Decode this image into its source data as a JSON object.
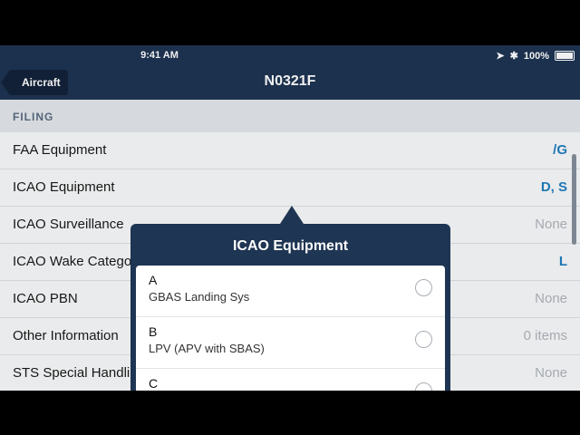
{
  "status_bar": {
    "time": "9:41 AM",
    "battery": "100%"
  },
  "nav": {
    "back_label": "Aircraft",
    "title": "N0321F"
  },
  "section": {
    "title": "FILING"
  },
  "rows": [
    {
      "label": "FAA Equipment",
      "value": "/G"
    },
    {
      "label": "ICAO Equipment",
      "value": "D, S"
    },
    {
      "label": "ICAO Surveillance",
      "value": "None"
    },
    {
      "label": "ICAO Wake Category",
      "value": "L"
    },
    {
      "label": "ICAO PBN",
      "value": "None"
    },
    {
      "label": "Other Information",
      "value": "0 items"
    },
    {
      "label": "STS Special Handling",
      "value": "None"
    }
  ],
  "popover": {
    "title": "ICAO Equipment",
    "options": [
      {
        "code": "A",
        "description": "GBAS Landing Sys"
      },
      {
        "code": "B",
        "description": "LPV (APV with SBAS)"
      },
      {
        "code": "C",
        "description": ""
      }
    ]
  },
  "colors": {
    "header": "#1e3553",
    "accent": "#1f7fc1",
    "muted": "#b0b5bc"
  }
}
